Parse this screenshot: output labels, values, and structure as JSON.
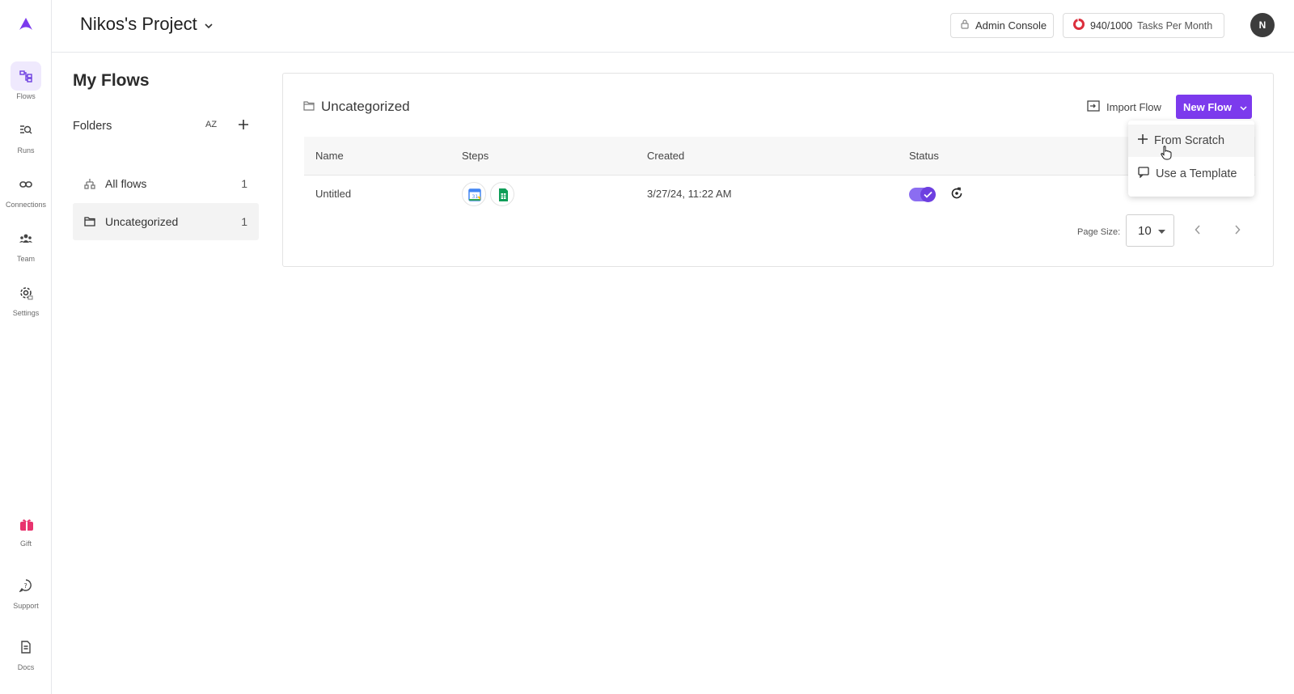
{
  "app": {
    "accent_color": "#7c3aed"
  },
  "rail": {
    "items": [
      {
        "label": "Flows",
        "icon": "flows-icon",
        "active": true
      },
      {
        "label": "Runs",
        "icon": "runs-icon"
      },
      {
        "label": "Connections",
        "icon": "link-icon"
      },
      {
        "label": "Team",
        "icon": "team-icon"
      },
      {
        "label": "Settings",
        "icon": "settings-icon"
      }
    ],
    "bottom": [
      {
        "label": "Gift",
        "icon": "gift-icon"
      },
      {
        "label": "Support",
        "icon": "support-icon"
      },
      {
        "label": "Docs",
        "icon": "docs-icon"
      }
    ]
  },
  "header": {
    "project_name": "Nikos's Project",
    "admin_console": "Admin Console",
    "tasks_used": "940/1000",
    "tasks_label": "Tasks Per Month",
    "avatar_initial": "N"
  },
  "sidebar": {
    "title": "My Flows",
    "folders_label": "Folders",
    "sort_label": "AZ",
    "folders": [
      {
        "name": "All flows",
        "count": "1"
      },
      {
        "name": "Uncategorized",
        "count": "1",
        "selected": true
      }
    ]
  },
  "main": {
    "folder_title": "Uncategorized",
    "import_flow": "Import Flow",
    "new_flow": "New Flow",
    "columns": [
      "Name",
      "Steps",
      "Created",
      "Status"
    ],
    "rows": [
      {
        "name": "Untitled",
        "steps": [
          "google-calendar-icon",
          "google-sheets-icon"
        ],
        "created": "3/27/24, 11:22 AM",
        "enabled": true
      }
    ],
    "page_size_label": "Page Size:",
    "page_size": "10"
  },
  "new_flow_menu": {
    "items": [
      {
        "label": "From Scratch",
        "icon": "plus-icon"
      },
      {
        "label": "Use a Template",
        "icon": "template-icon"
      }
    ]
  }
}
